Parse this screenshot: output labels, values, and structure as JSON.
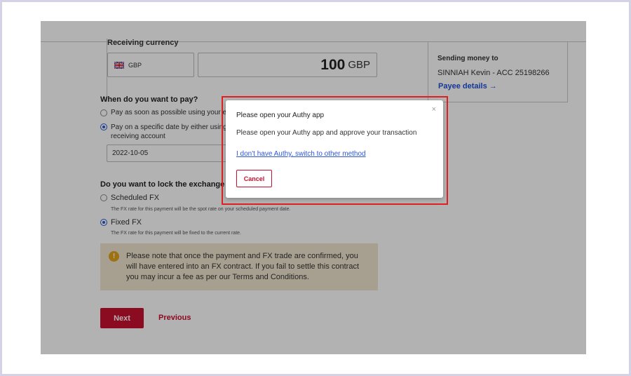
{
  "form": {
    "receiving_currency_label": "Receiving currency",
    "currency_code": "GBP",
    "amount_value": "100",
    "amount_currency": "GBP",
    "pay_question": "When do you want to pay?",
    "pay_option_asap": "Pay as soon as possible using your existin",
    "pay_option_date_line1": "Pay on a specific date by either using your",
    "pay_option_date_line2": "receiving account",
    "date_value": "2022-10-05",
    "lock_question": "Do you want to lock the exchange rate a",
    "fx_scheduled_label": "Scheduled FX",
    "fx_scheduled_desc": "The FX rate for this payment will be the spot rate on your scheduled payment date.",
    "fx_fixed_label": "Fixed FX",
    "fx_fixed_desc": "The FX rate for this payment will be fixed to the current rate.",
    "notice_text": "Please note that once the payment and FX trade are confirmed, you will have entered into an FX contract. If you fail to settle this contract you may incur a fee as per our Terms and Conditions.",
    "next_label": "Next",
    "previous_label": "Previous"
  },
  "sidebar": {
    "title": "Sending money to",
    "payee": "SINNIAH Kevin - ACC 25198266",
    "payee_link": "Payee details →"
  },
  "modal": {
    "title": "Please open your Authy app",
    "body": "Please open your Authy app and approve your transaction",
    "switch_link": "I don't have Authy, switch to other method",
    "cancel_label": "Cancel",
    "close_glyph": "×"
  },
  "colors": {
    "brand_red": "#c8102e",
    "link_blue": "#2d55d8",
    "highlight": "#e02020",
    "notice_bg": "#efe6cf"
  }
}
